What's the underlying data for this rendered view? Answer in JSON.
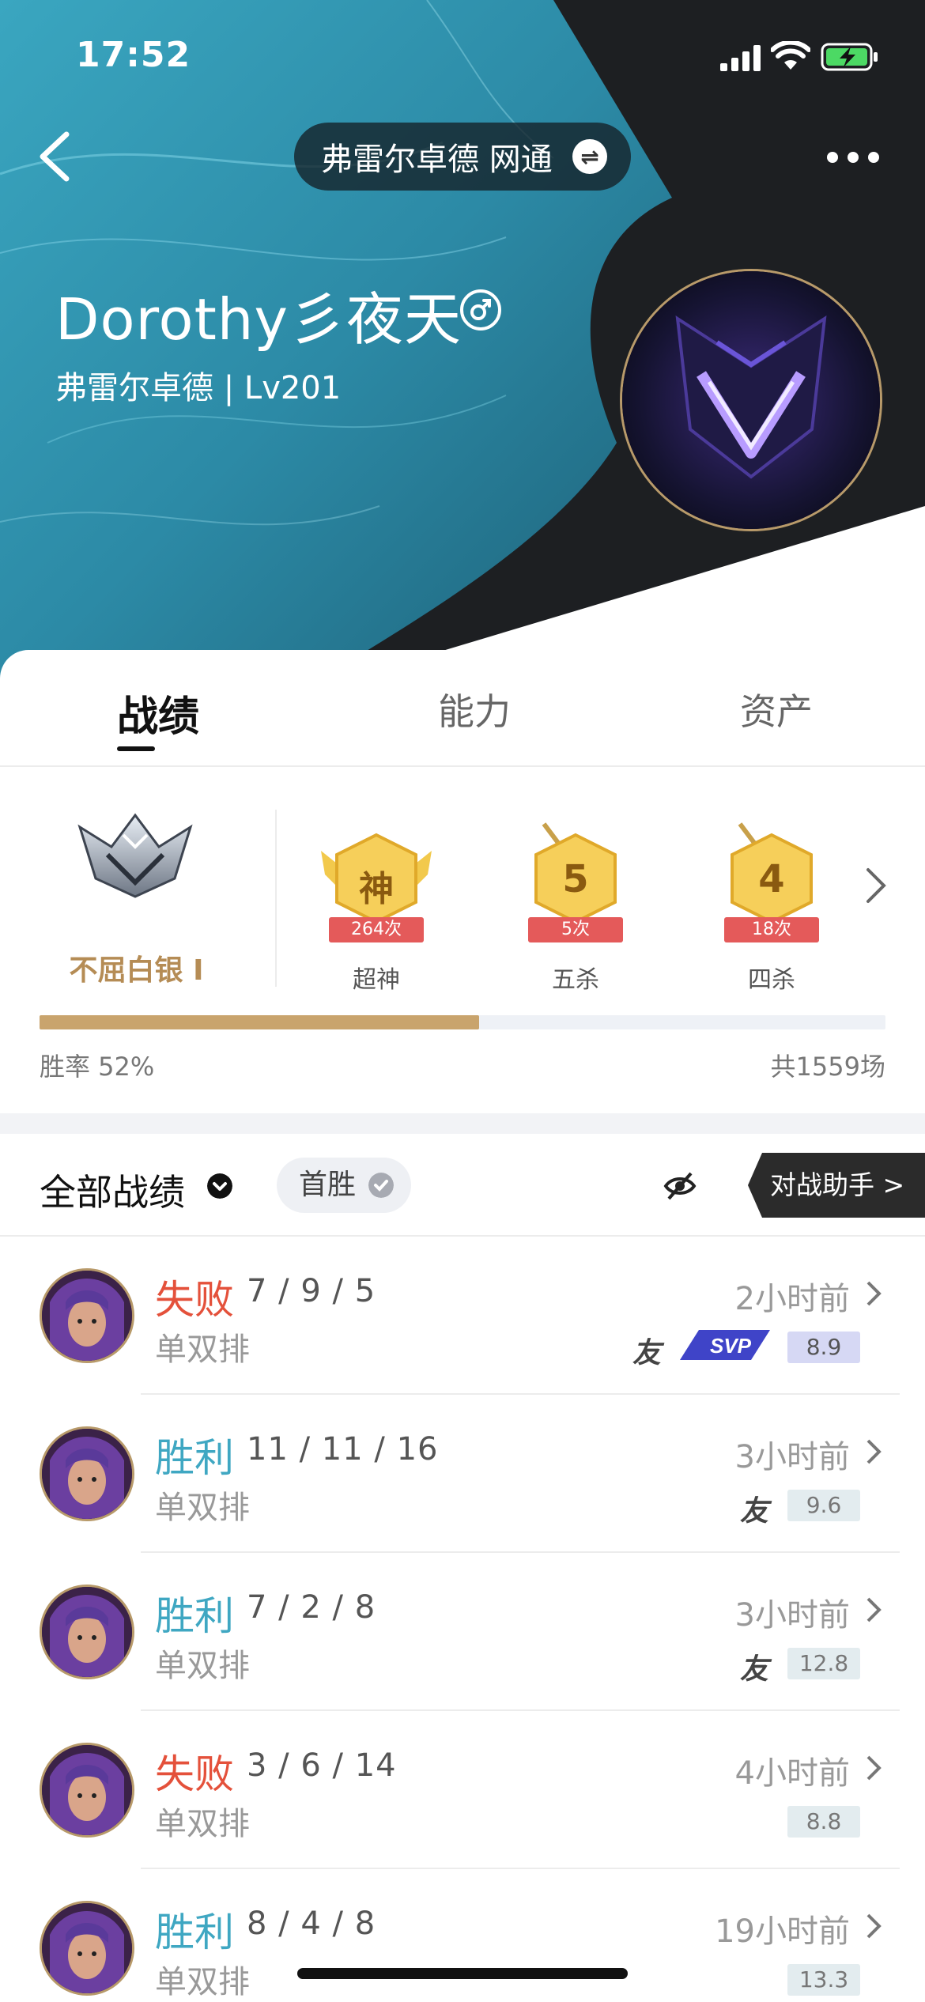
{
  "status_bar": {
    "time": "17:52"
  },
  "header": {
    "server_selector": "弗雷尔卓德 网通",
    "player_name": "Dorothy彡夜天",
    "player_sub": "弗雷尔卓德 | Lv201"
  },
  "tabs": [
    {
      "label": "战绩",
      "active": true
    },
    {
      "label": "能力",
      "active": false
    },
    {
      "label": "资产",
      "active": false
    }
  ],
  "rank": {
    "label": "不屈白银 I"
  },
  "badges": [
    {
      "glyph": "神",
      "count": "264次",
      "caption": "超神"
    },
    {
      "glyph": "5",
      "count": "5次",
      "caption": "五杀"
    },
    {
      "glyph": "4",
      "count": "18次",
      "caption": "四杀"
    }
  ],
  "winrate": {
    "label": "胜率 52%",
    "value": 0.52,
    "total": "共1559场"
  },
  "filter": {
    "all_label": "全部战绩",
    "first_win": "首胜",
    "assistant": "对战助手 >"
  },
  "matches": [
    {
      "result": "失败",
      "outcome": "lose",
      "kda": "7 / 9 / 5",
      "mode": "单双排",
      "ago": "2小时前",
      "score": "8.9",
      "friend": "友",
      "svp": true
    },
    {
      "result": "胜利",
      "outcome": "win",
      "kda": "11 / 11 / 16",
      "mode": "单双排",
      "ago": "3小时前",
      "score": "9.6",
      "friend": "友",
      "svp": false
    },
    {
      "result": "胜利",
      "outcome": "win",
      "kda": "7 / 2 / 8",
      "mode": "单双排",
      "ago": "3小时前",
      "score": "12.8",
      "friend": "友",
      "svp": false
    },
    {
      "result": "失败",
      "outcome": "lose",
      "kda": "3 / 6 / 14",
      "mode": "单双排",
      "ago": "4小时前",
      "score": "8.8",
      "friend": "",
      "svp": false
    },
    {
      "result": "胜利",
      "outcome": "win",
      "kda": "8 / 4 / 8",
      "mode": "单双排",
      "ago": "19小时前",
      "score": "13.3",
      "friend": "",
      "svp": false
    }
  ],
  "colors": {
    "lose": "#e4513b",
    "win": "#3fa7c2",
    "rank_gold": "#c9a46d"
  }
}
